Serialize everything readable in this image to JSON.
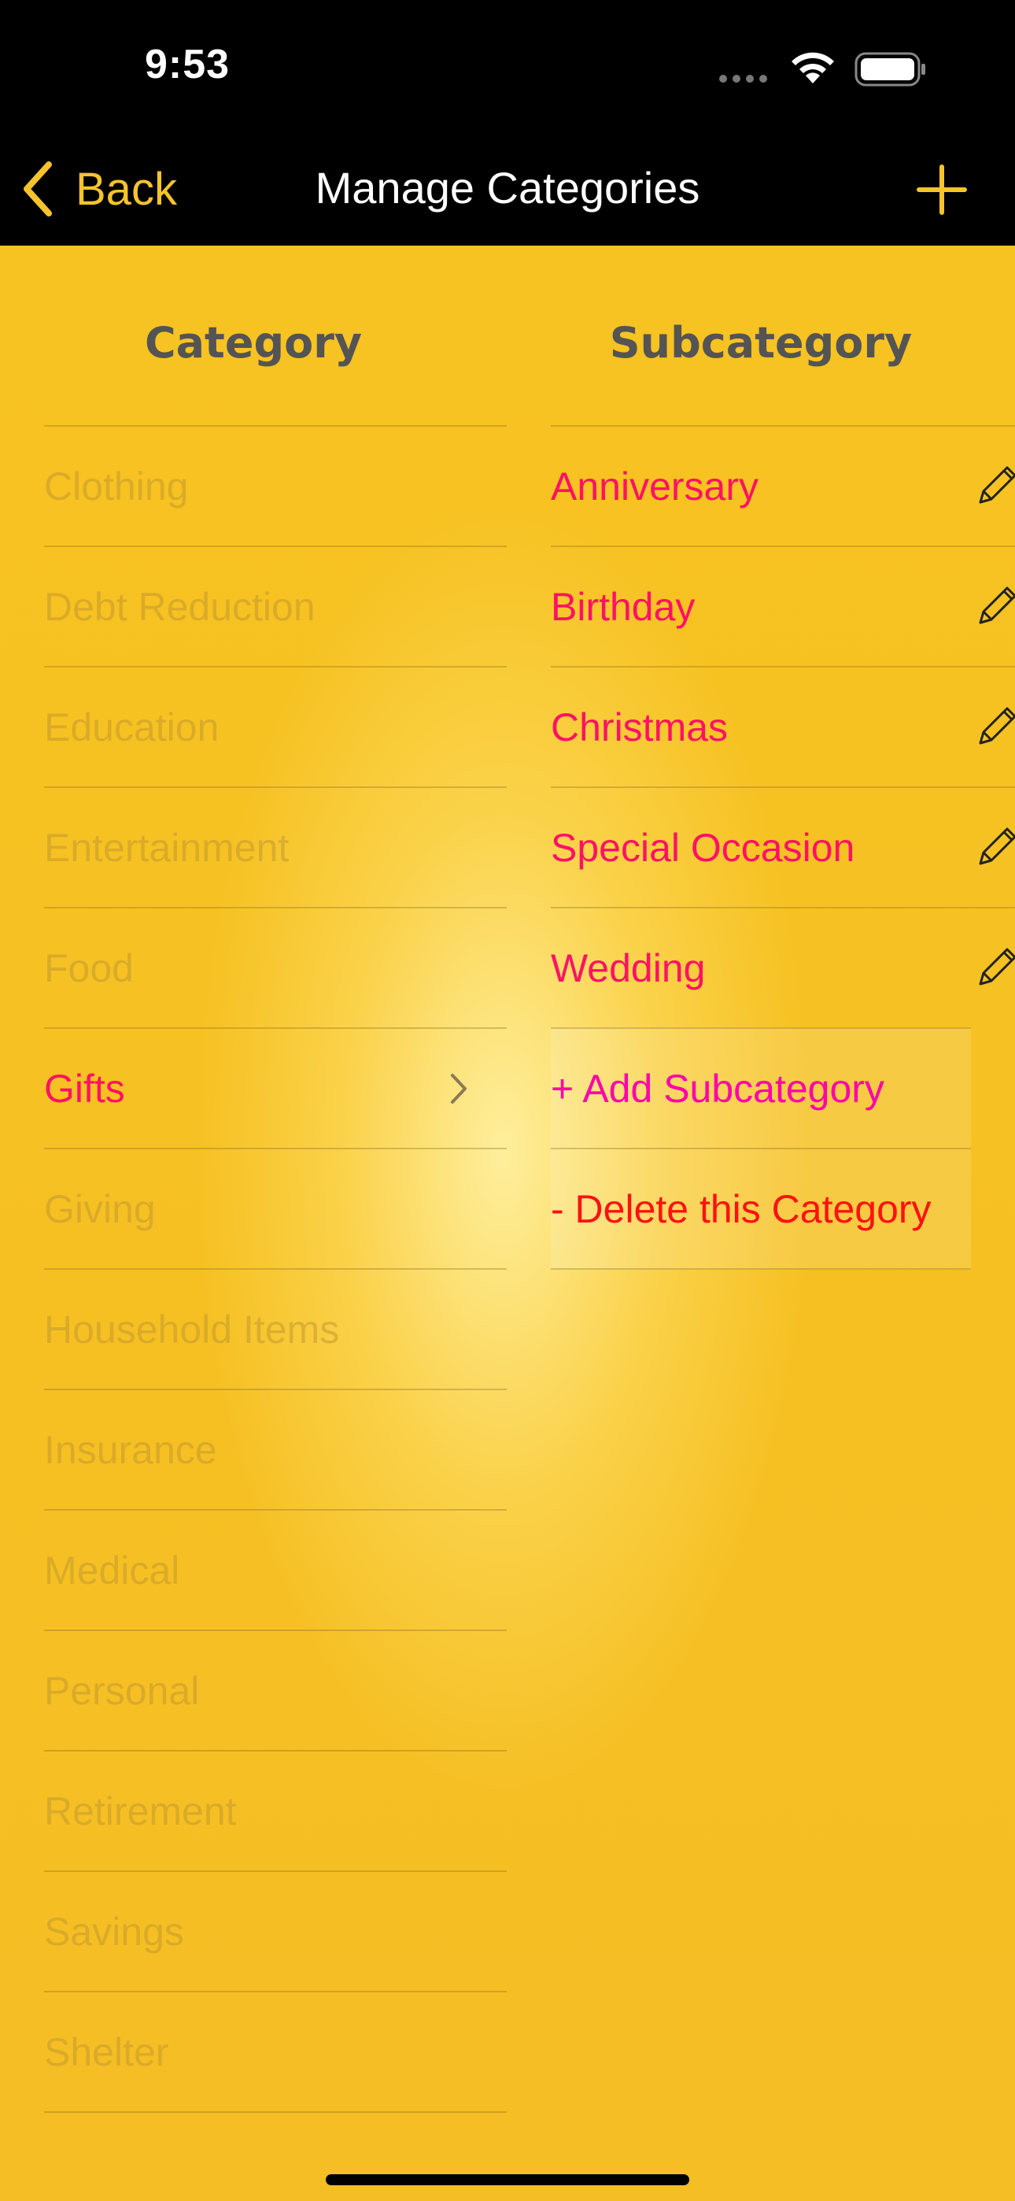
{
  "status": {
    "time": "9:53"
  },
  "nav": {
    "back_label": "Back",
    "title": "Manage Categories"
  },
  "columns": {
    "category": "Category",
    "subcategory": "Subcategory"
  },
  "categories": [
    {
      "label": "Clothing"
    },
    {
      "label": "Debt Reduction"
    },
    {
      "label": "Education"
    },
    {
      "label": "Entertainment"
    },
    {
      "label": "Food"
    },
    {
      "label": "Gifts",
      "selected": true
    },
    {
      "label": "Giving"
    },
    {
      "label": "Household Items"
    },
    {
      "label": "Insurance"
    },
    {
      "label": "Medical"
    },
    {
      "label": "Personal"
    },
    {
      "label": "Retirement"
    },
    {
      "label": "Savings"
    },
    {
      "label": "Shelter"
    }
  ],
  "subcategories": [
    {
      "label": "Anniversary"
    },
    {
      "label": "Birthday"
    },
    {
      "label": "Christmas"
    },
    {
      "label": "Special Occasion"
    },
    {
      "label": "Wedding"
    }
  ],
  "actions": {
    "add": "+ Add Subcategory",
    "delete": "- Delete this Category"
  },
  "colors": {
    "accent": "#F5C42C",
    "background": "#F5BE24",
    "selected_text": "#FF1166",
    "add_text": "#FF00AA",
    "delete_text": "#FF1111",
    "header_text": "#545454"
  },
  "icons": [
    "chevron-left-icon",
    "plus-icon",
    "pencil-icon",
    "chevron-right-icon",
    "wifi-icon",
    "battery-icon",
    "cellular-signal-icon"
  ]
}
